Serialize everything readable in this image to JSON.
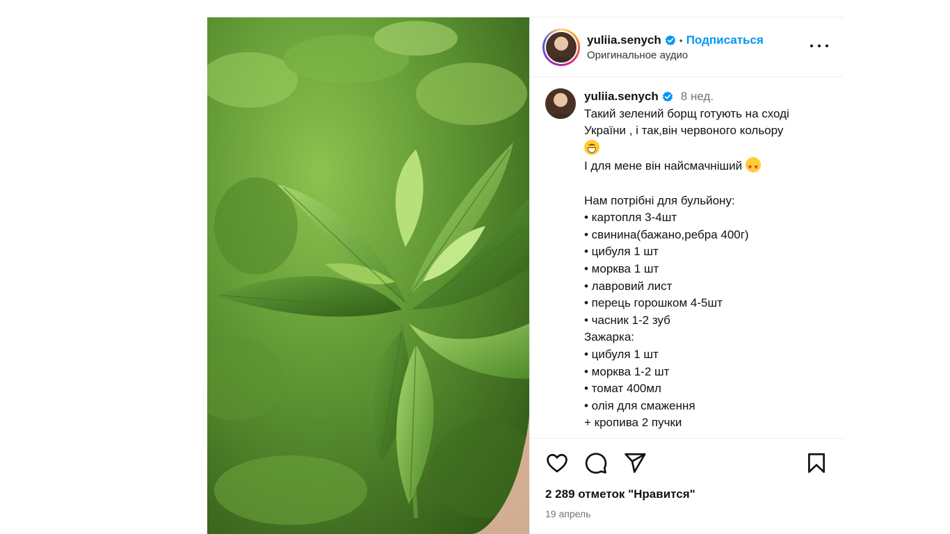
{
  "post": {
    "header": {
      "username": "yuliia.senych",
      "separator": "•",
      "follow_label": "Подписаться",
      "audio_label": "Оригинальное аудио"
    },
    "caption": {
      "username": "yuliia.senych",
      "time_ago": "8 нед.",
      "lines": [
        "Такий зелений борщ готують на сході",
        "України , і так,він червоного кольору",
        "",
        "І для мене він найсмачніший ",
        "",
        "Нам потрібні для бульйону:",
        "• картопля 3-4шт",
        "• свинина(бажано,ребра 400г)",
        "• цибуля 1 шт",
        "• морква 1 шт",
        "• лавровий лист",
        "• перець горошком 4-5шт",
        "• часник 1-2 зуб",
        "Зажарка:",
        "• цибуля 1 шт",
        "• морква 1-2 шт",
        "• томат 400мл",
        "• олія для смаження",
        "+ кропива 2 пучки"
      ]
    },
    "likes_text": "2 289 отметок \"Нравится\"",
    "date_text": "19 апрель"
  },
  "icons": {
    "like": "heart-icon",
    "comment": "comment-icon",
    "share": "share-icon",
    "save": "bookmark-icon",
    "verified": "verified-badge-icon",
    "more": "more-options-icon"
  },
  "colors": {
    "accent": "#0095f6",
    "secondary_text": "#737373",
    "border": "#efefef"
  }
}
